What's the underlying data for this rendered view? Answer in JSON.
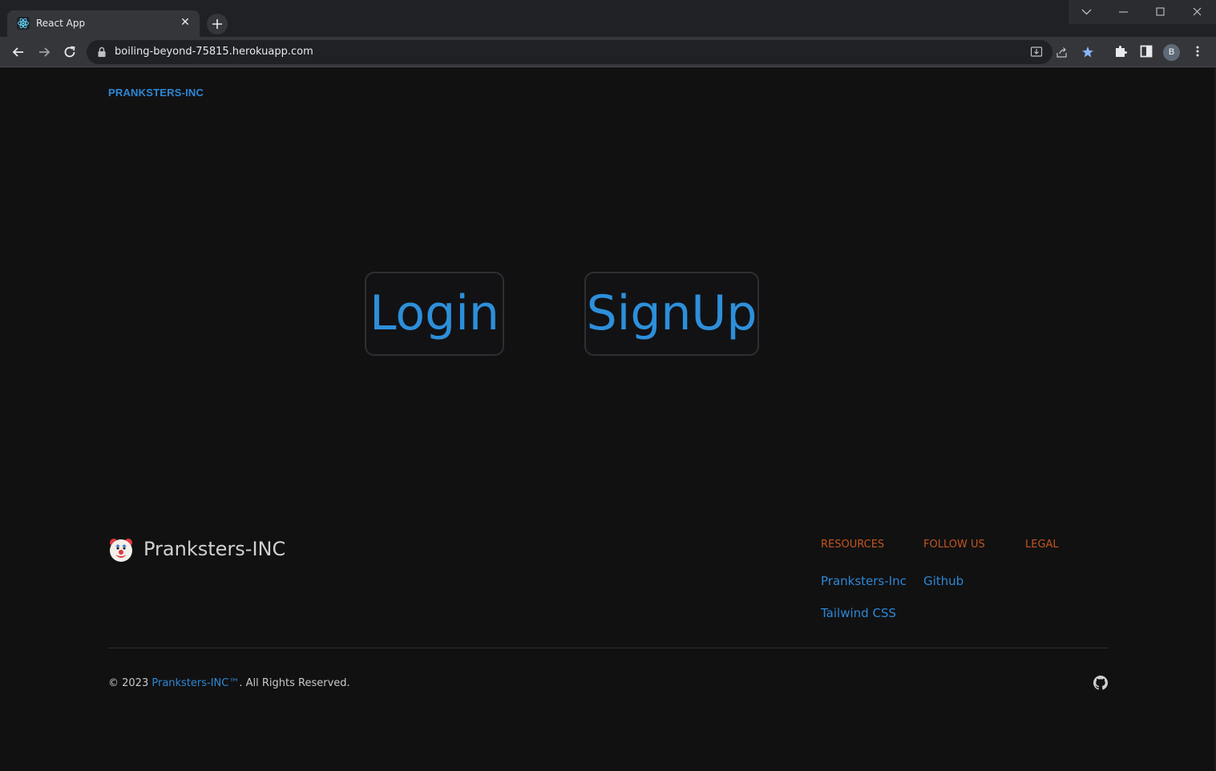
{
  "browser": {
    "tab_title": "React App",
    "tab_close": "✕",
    "url": "boiling-beyond-75815.herokuapp.com",
    "profile_initial": "B"
  },
  "header": {
    "brand": "PRANKSTERS-INC"
  },
  "hero": {
    "login_label": "Login",
    "signup_label": "SignUp"
  },
  "footer": {
    "brand": "Pranksters-INC",
    "columns": [
      {
        "heading": "Resources",
        "links": [
          "Pranksters-Inc",
          "Tailwind CSS"
        ]
      },
      {
        "heading": "Follow us",
        "links": [
          "Github"
        ]
      },
      {
        "heading": "Legal",
        "links": []
      }
    ],
    "copyright_prefix": "© 2023 ",
    "copyright_link": "Pranksters-INC™",
    "copyright_suffix": ". All Rights Reserved."
  },
  "colors": {
    "accent_blue": "#2d87d4",
    "heading_orange": "#c2561d",
    "background": "#111112"
  },
  "icons": [
    "react-favicon-icon",
    "back-arrow-icon",
    "forward-arrow-icon",
    "reload-icon",
    "lock-icon",
    "install-icon",
    "share-icon",
    "bookmark-star-icon",
    "extensions-puzzle-icon",
    "side-panel-icon",
    "more-vert-icon",
    "clown-face-icon",
    "github-icon"
  ]
}
